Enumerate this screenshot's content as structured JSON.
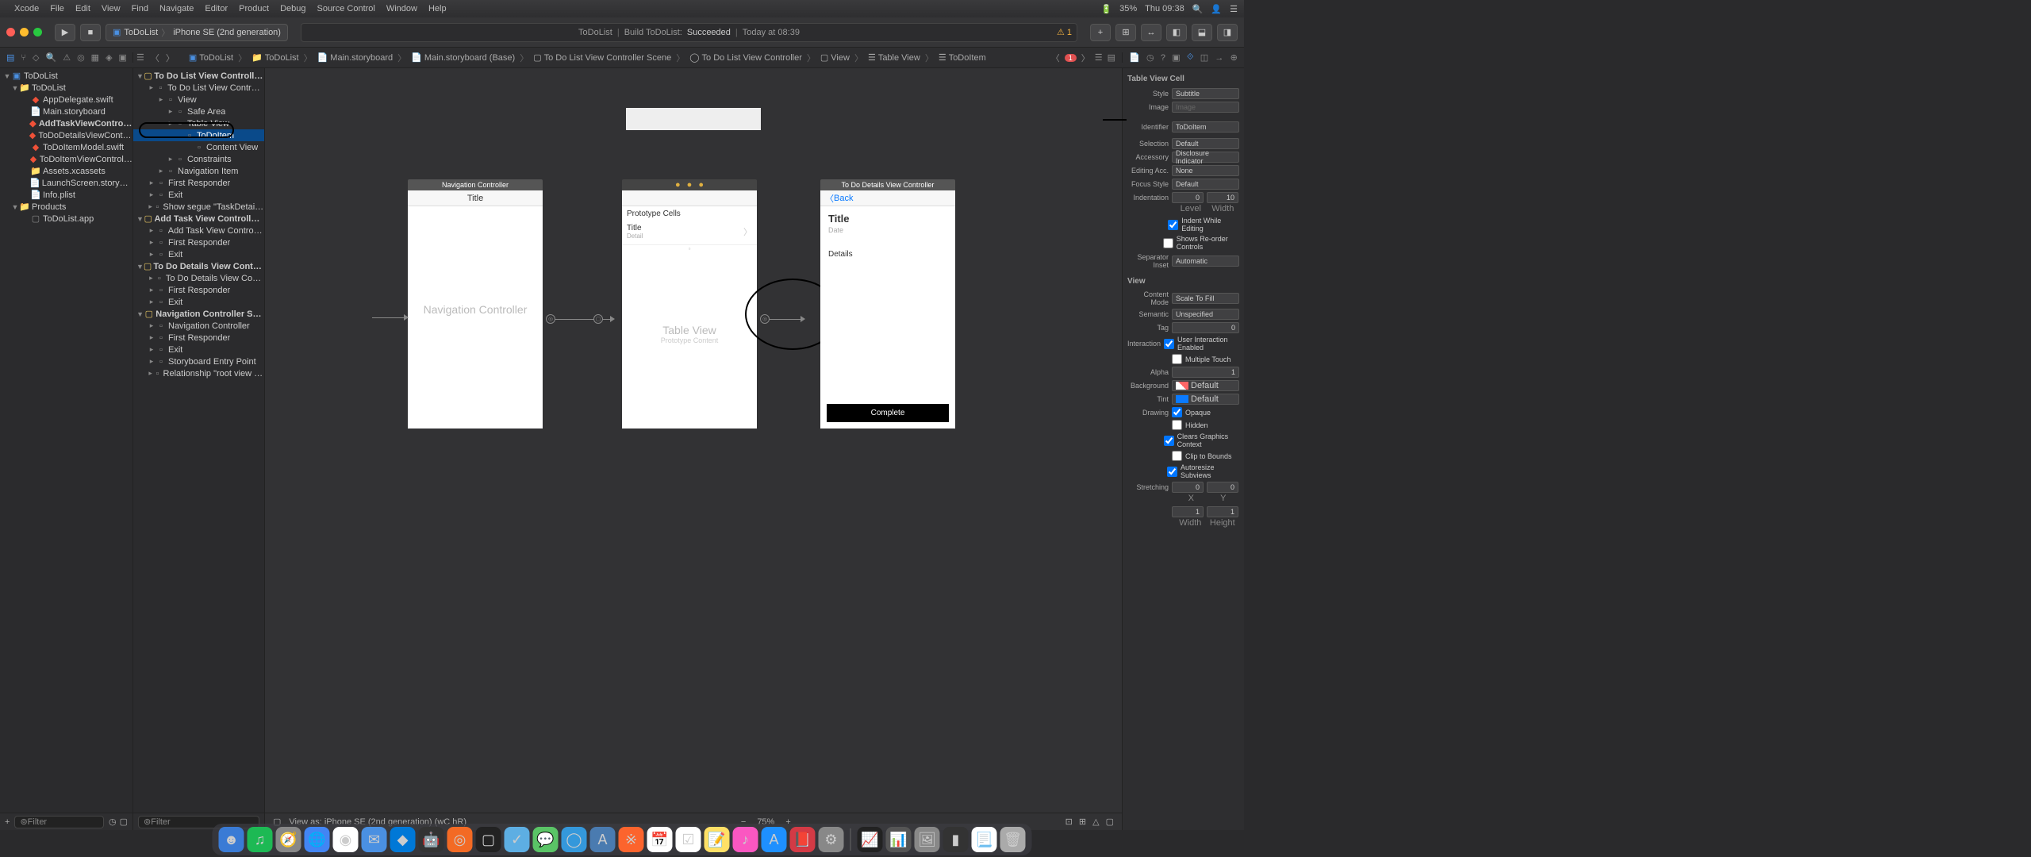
{
  "menubar": {
    "items": [
      "Xcode",
      "File",
      "Edit",
      "View",
      "Find",
      "Navigate",
      "Editor",
      "Product",
      "Debug",
      "Source Control",
      "Window",
      "Help"
    ],
    "battery": "35%",
    "clock": "Thu 09:38"
  },
  "toolbar": {
    "scheme_app": "ToDoList",
    "scheme_device": "iPhone SE (2nd generation)",
    "status_project": "ToDoList",
    "status_build": "Build ToDoList:",
    "status_result": "Succeeded",
    "status_time": "Today at 08:39",
    "warn_count": "1"
  },
  "navigator": {
    "root": "ToDoList",
    "items": [
      {
        "name": "ToDoList",
        "type": "folder",
        "indent": 1
      },
      {
        "name": "AppDelegate.swift",
        "type": "swift",
        "indent": 2
      },
      {
        "name": "Main.storyboard",
        "type": "storyboard",
        "indent": 2
      },
      {
        "name": "AddTaskViewController.swift",
        "type": "swift",
        "indent": 2,
        "bold": true
      },
      {
        "name": "ToDoDetailsViewController.swift",
        "type": "swift",
        "indent": 2
      },
      {
        "name": "ToDoItemModel.swift",
        "type": "swift",
        "indent": 2
      },
      {
        "name": "ToDoItemViewController.swift",
        "type": "swift",
        "indent": 2
      },
      {
        "name": "Assets.xcassets",
        "type": "folder",
        "indent": 2
      },
      {
        "name": "LaunchScreen.storyboard",
        "type": "storyboard",
        "indent": 2
      },
      {
        "name": "Info.plist",
        "type": "plist",
        "indent": 2
      },
      {
        "name": "Products",
        "type": "folder",
        "indent": 1
      },
      {
        "name": "ToDoList.app",
        "type": "app",
        "indent": 2
      }
    ]
  },
  "breadcrumbs": [
    "ToDoList",
    "ToDoList",
    "Main.storyboard",
    "Main.storyboard (Base)",
    "To Do List View Controller Scene",
    "To Do List View Controller",
    "View",
    "Table View",
    "ToDoItem"
  ],
  "outline": {
    "scenes": [
      {
        "title": "To Do List View Controller Scene",
        "items": [
          {
            "label": "To Do List View Controller",
            "indent": 1
          },
          {
            "label": "View",
            "indent": 2
          },
          {
            "label": "Safe Area",
            "indent": 3
          },
          {
            "label": "Table View",
            "indent": 3,
            "circled": true
          },
          {
            "label": "ToDoItem",
            "indent": 4,
            "selected": true
          },
          {
            "label": "Content View",
            "indent": 5
          },
          {
            "label": "Constraints",
            "indent": 3
          },
          {
            "label": "Navigation Item",
            "indent": 2
          },
          {
            "label": "First Responder",
            "indent": 1
          },
          {
            "label": "Exit",
            "indent": 1
          },
          {
            "label": "Show segue \"TaskDetailsSegue\" t…",
            "indent": 1
          }
        ]
      },
      {
        "title": "Add Task View Controller Scene",
        "items": [
          {
            "label": "Add Task View Controller",
            "indent": 1
          },
          {
            "label": "First Responder",
            "indent": 1
          },
          {
            "label": "Exit",
            "indent": 1
          }
        ]
      },
      {
        "title": "To Do Details View Controller Scene",
        "items": [
          {
            "label": "To Do Details View Controller",
            "indent": 1
          },
          {
            "label": "First Responder",
            "indent": 1
          },
          {
            "label": "Exit",
            "indent": 1
          }
        ]
      },
      {
        "title": "Navigation Controller Scene",
        "items": [
          {
            "label": "Navigation Controller",
            "indent": 1
          },
          {
            "label": "First Responder",
            "indent": 1
          },
          {
            "label": "Exit",
            "indent": 1
          },
          {
            "label": "Storyboard Entry Point",
            "indent": 1
          },
          {
            "label": "Relationship \"root view controller\"…",
            "indent": 1
          }
        ]
      }
    ]
  },
  "canvas": {
    "nav_title": "Navigation Controller",
    "nav_placeholder": "Navigation Controller",
    "proto_header": "Prototype Cells",
    "cell_title": "Title",
    "cell_detail": "Detail",
    "tv_placeholder": "Table View",
    "tv_sub": "Prototype Content",
    "details_header": "To Do Details View Controller",
    "back": "Back",
    "d_title": "Title",
    "d_date": "Date",
    "d_details": "Details",
    "complete": "Complete",
    "title_word": "Title"
  },
  "canvas_footer": {
    "viewas": "View as: iPhone SE (2nd generation) (wC hR)",
    "zoom": "75%"
  },
  "inspector": {
    "section1": "Table View Cell",
    "style_label": "Style",
    "style_val": "Subtitle",
    "image_label": "Image",
    "image_val": "Image",
    "identifier_label": "Identifier",
    "identifier_val": "ToDoItem",
    "selection_label": "Selection",
    "selection_val": "Default",
    "accessory_label": "Accessory",
    "accessory_val": "Disclosure Indicator",
    "editingacc_label": "Editing Acc.",
    "editingacc_val": "None",
    "focusstyle_label": "Focus Style",
    "focusstyle_val": "Default",
    "indent_label": "Indentation",
    "indent_level": "0",
    "indent_width": "10",
    "indent_l": "Level",
    "indent_w": "Width",
    "indent_while": "Indent While Editing",
    "reorder": "Shows Re-order Controls",
    "sepinset_label": "Separator Inset",
    "sepinset_val": "Automatic",
    "section2": "View",
    "cmode_label": "Content Mode",
    "cmode_val": "Scale To Fill",
    "semantic_label": "Semantic",
    "semantic_val": "Unspecified",
    "tag_label": "Tag",
    "tag_val": "0",
    "interaction_label": "Interaction",
    "uie": "User Interaction Enabled",
    "multi": "Multiple Touch",
    "alpha_label": "Alpha",
    "alpha_val": "1",
    "bg_label": "Background",
    "bg_val": "Default",
    "tint_label": "Tint",
    "tint_val": "Default",
    "drawing_label": "Drawing",
    "opaque": "Opaque",
    "hidden": "Hidden",
    "clears": "Clears Graphics Context",
    "clip": "Clip to Bounds",
    "autoresize": "Autoresize Subviews",
    "stretch_label": "Stretching",
    "stretch_x": "0",
    "stretch_y": "0",
    "xl": "X",
    "yl": "Y",
    "stretch_w": "1",
    "stretch_h": "1",
    "wl": "Width",
    "hl": "Height"
  },
  "filter_placeholder": "Filter"
}
